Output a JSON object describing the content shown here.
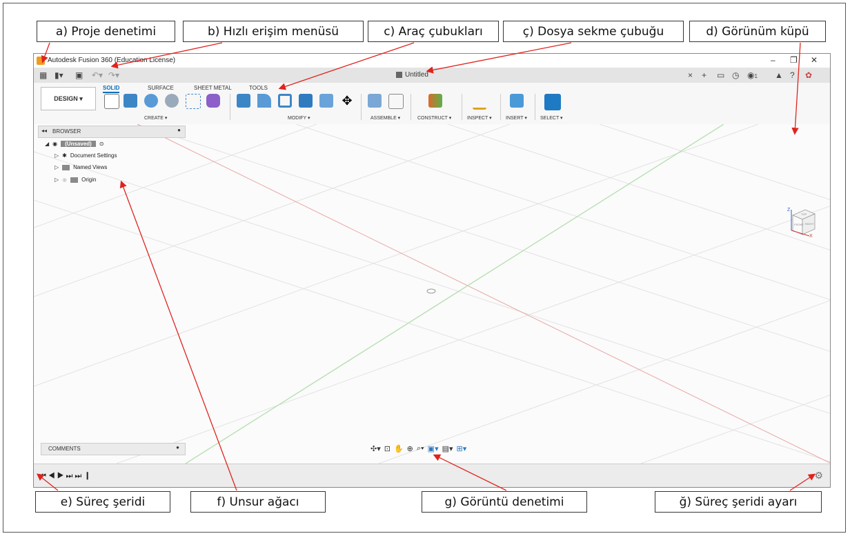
{
  "labels": {
    "a": "a) Proje denetimi",
    "b": "b) Hızlı erişim menüsü",
    "c": "c) Araç çubukları",
    "c2": "ç) Dosya sekme çubuğu",
    "d": "d) Görünüm küpü",
    "e": "e) Süreç şeridi",
    "f": "f) Unsur ağacı",
    "g": "g) Görüntü denetimi",
    "g2": "ğ) Süreç şeridi ayarı"
  },
  "app": {
    "title": "Autodesk Fusion 360 (Education License)",
    "document_tab": "Untitled",
    "workspace_button": "DESIGN ▾",
    "ribbon_tabs": [
      "SOLID",
      "SURFACE",
      "SHEET METAL",
      "TOOLS"
    ],
    "groups": [
      "CREATE ▾",
      "MODIFY ▾",
      "ASSEMBLE ▾",
      "CONSTRUCT ▾",
      "INSPECT ▾",
      "INSERT ▾",
      "SELECT ▾"
    ],
    "browser": {
      "title": "BROWSER",
      "root": "(Unsaved)",
      "items": [
        "Document Settings",
        "Named Views",
        "Origin"
      ]
    },
    "comments": "COMMENTS",
    "job_count": "1",
    "viewcube_axes": [
      "Z",
      "X"
    ],
    "viewcube_faces": [
      "TOP",
      "FRONT",
      "RIGHT"
    ]
  },
  "colors": {
    "accent": "#0a6ebd",
    "arrow": "#e0231d",
    "x_axis": "#d66",
    "y_axis": "#7c7"
  }
}
